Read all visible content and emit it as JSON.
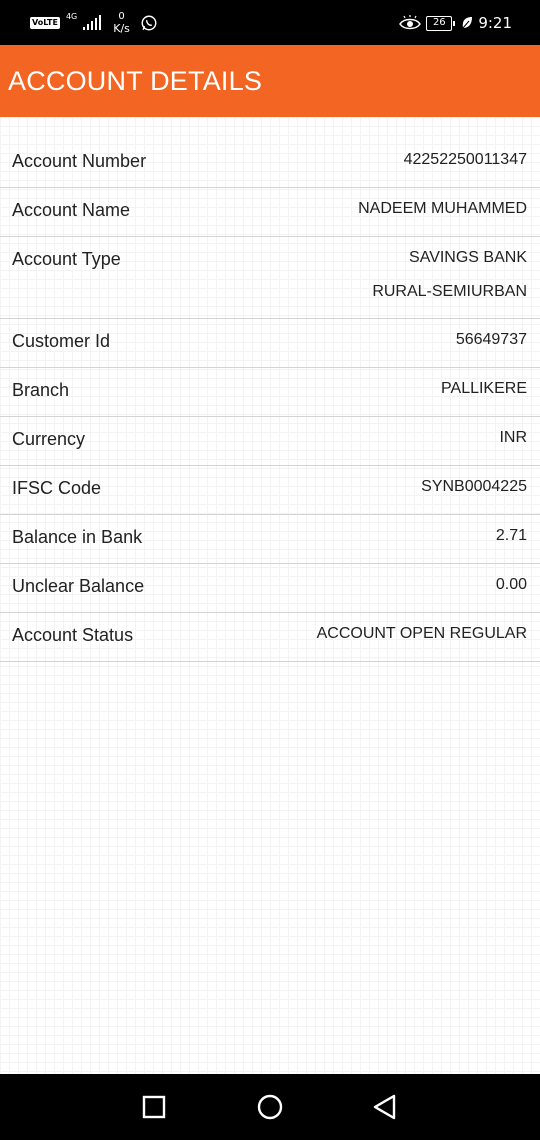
{
  "status_bar": {
    "volte": "VoLTE",
    "network": "4G",
    "speed_value": "0",
    "speed_unit": "K/s",
    "battery": "26",
    "time": "9:21",
    "icons": [
      "volte-icon",
      "signal-icon",
      "whatsapp-icon",
      "eye-comfort-icon",
      "battery-icon",
      "leaf-icon"
    ]
  },
  "header": {
    "title": "ACCOUNT DETAILS",
    "color": "#f26522"
  },
  "details": [
    {
      "label": "Account Number",
      "value": "42252250011347"
    },
    {
      "label": "Account Name",
      "value": "NADEEM MUHAMMED"
    },
    {
      "label": "Account Type",
      "value": "SAVINGS BANK",
      "value_line2": "RURAL-SEMIURBAN"
    },
    {
      "label": "Customer Id",
      "value": "56649737"
    },
    {
      "label": "Branch",
      "value": "PALLIKERE"
    },
    {
      "label": "Currency",
      "value": "INR"
    },
    {
      "label": "IFSC Code",
      "value": "SYNB0004225"
    },
    {
      "label": "Balance in Bank",
      "value": "2.71"
    },
    {
      "label": "Unclear Balance",
      "value": "0.00"
    },
    {
      "label": "Account Status",
      "value": "ACCOUNT OPEN REGULAR"
    }
  ],
  "nav_bar": {
    "icons": [
      "recent-apps-icon",
      "home-icon",
      "back-icon"
    ]
  }
}
